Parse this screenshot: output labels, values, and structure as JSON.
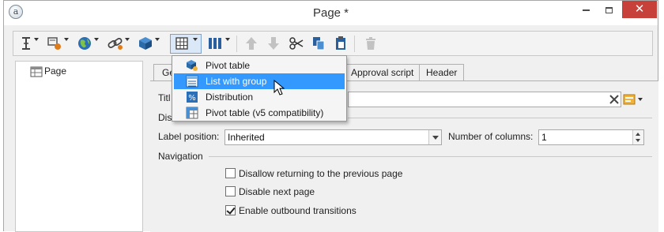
{
  "window": {
    "title": "Page *",
    "app_icon_glyph": "a",
    "close_glyph": "✕"
  },
  "toolbar": {
    "buttons": [
      "insert-cursor-icon",
      "field-icon",
      "globe-icon",
      "link-icon",
      "cube-icon",
      "grid-icon",
      "columns-icon",
      "move-up-icon",
      "move-down-icon",
      "cut-icon",
      "copy-icon",
      "paste-icon",
      "delete-icon"
    ]
  },
  "tree": {
    "items": [
      {
        "label": "Page",
        "icon": "page-grid-icon"
      }
    ]
  },
  "tabs": [
    {
      "label": "Ger"
    },
    {
      "label": "Approval script"
    },
    {
      "label": "Header"
    }
  ],
  "form": {
    "title_label": "Titl",
    "display_label": "Dis",
    "label_position_label": "Label position:",
    "label_position_value": "Inherited",
    "number_of_columns_label": "Number of columns:",
    "number_of_columns_value": "1",
    "navigation_label": "Navigation",
    "checkboxes": [
      {
        "label": "Disallow returning to the previous page",
        "checked": false
      },
      {
        "label": "Disable next page",
        "checked": false
      },
      {
        "label": "Enable outbound transitions",
        "checked": true
      }
    ]
  },
  "menu": {
    "items": [
      {
        "label": "Pivot table",
        "icon": "pivot-cube-icon",
        "selected": false
      },
      {
        "label": "List with group",
        "icon": "list-group-icon",
        "selected": true
      },
      {
        "label": "Distribution",
        "icon": "percent-icon",
        "selected": false
      },
      {
        "label": "Pivot table (v5 compatibility)",
        "icon": "pivot-grid-icon",
        "selected": false
      }
    ]
  },
  "colors": {
    "accent": "#3399ff",
    "close_button": "#c7403a",
    "toolbar_selected": "#dbe8f7",
    "checkmark": "#222222"
  }
}
